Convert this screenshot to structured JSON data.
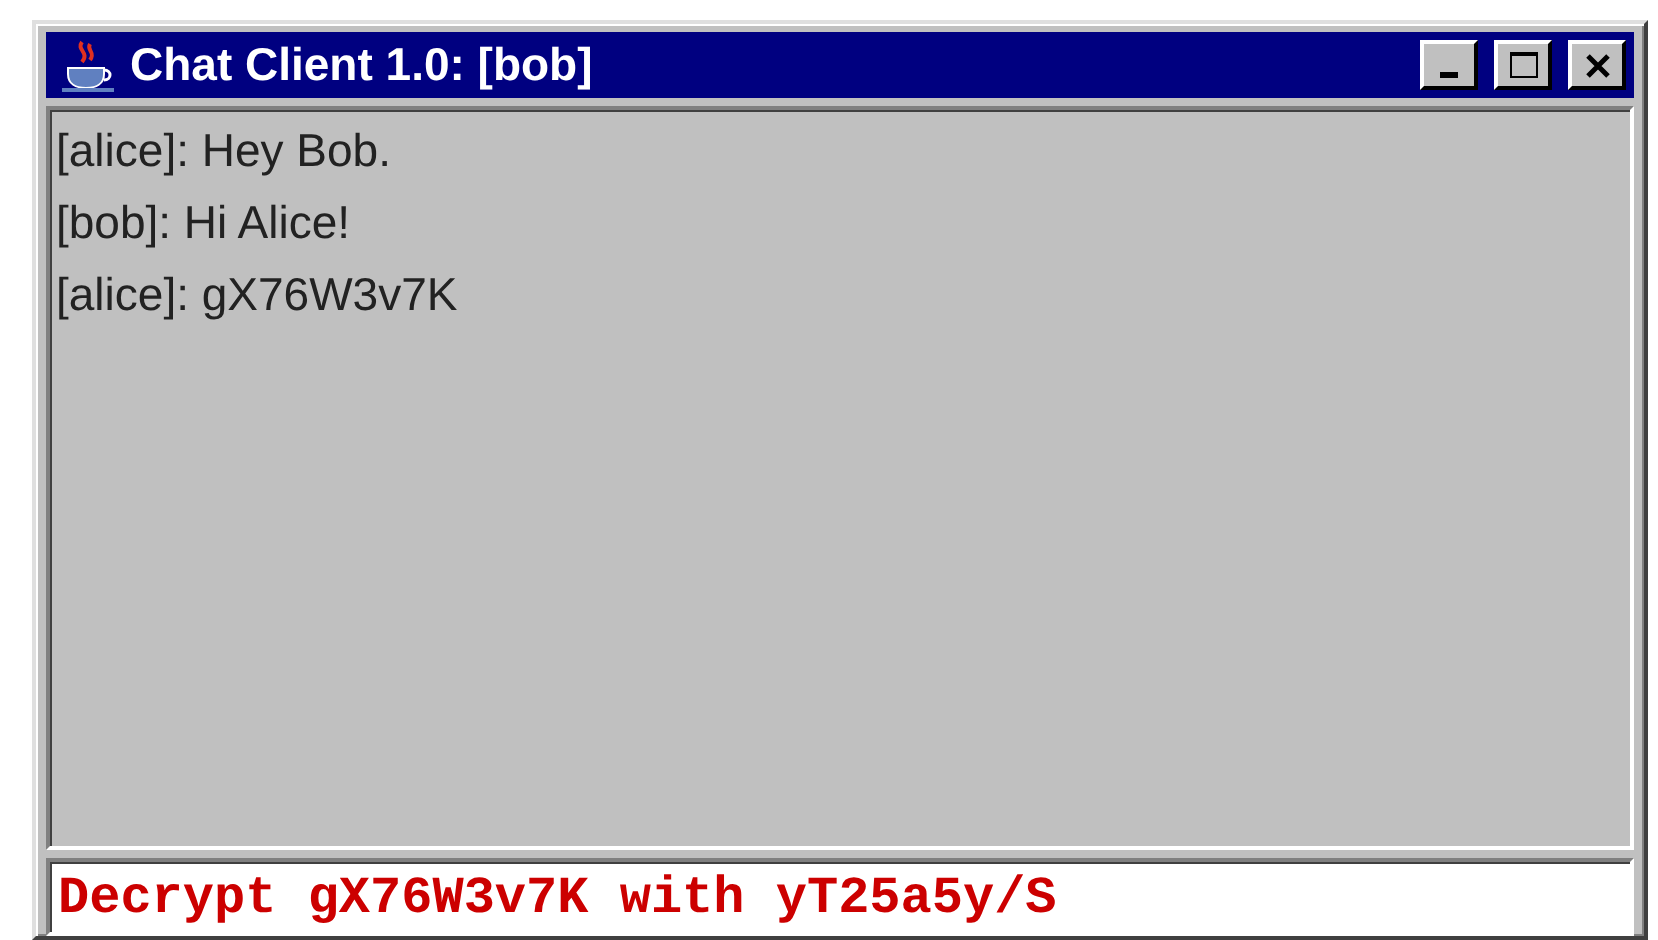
{
  "window": {
    "title": "Chat Client 1.0: [bob]"
  },
  "messages": [
    {
      "text": "[alice]: Hey Bob."
    },
    {
      "text": "[bob]: Hi Alice!"
    },
    {
      "text": "[alice]: gX76W3v7K"
    }
  ],
  "input": {
    "value": "Decrypt gX76W3v7K with yT25a5y/S"
  }
}
